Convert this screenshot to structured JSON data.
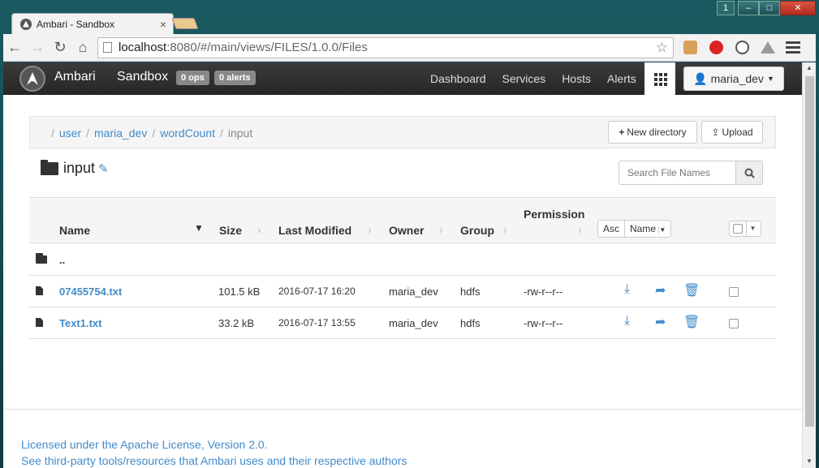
{
  "browser": {
    "tab_title": "Ambari - Sandbox",
    "tab_close": "×",
    "user_badge": "1",
    "url_host": "localhost",
    "url_rest": ":8080/#/main/views/FILES/1.0.0/Files",
    "star": "☆"
  },
  "navbar": {
    "brand": "Ambari",
    "cluster": "Sandbox",
    "ops_badge": "0 ops",
    "alerts_badge": "0 alerts",
    "links": [
      "Dashboard",
      "Services",
      "Hosts",
      "Alerts"
    ],
    "user": "maria_dev"
  },
  "breadcrumb": {
    "items": [
      "user",
      "maria_dev",
      "wordCount"
    ],
    "current": "input",
    "sep": "/"
  },
  "toolbar": {
    "new_directory": "New directory",
    "upload": "Upload"
  },
  "folder": {
    "name": "input"
  },
  "search": {
    "placeholder": "Search File Names"
  },
  "table": {
    "headers": {
      "name": "Name",
      "size": "Size",
      "modified": "Last Modified",
      "owner": "Owner",
      "group": "Group",
      "permission": "Permission"
    },
    "sort": {
      "order": "Asc",
      "field": "Name"
    },
    "parent": "..",
    "rows": [
      {
        "name": "07455754.txt",
        "size": "101.5 kB",
        "modified": "2016-07-17 16:20",
        "owner": "maria_dev",
        "group": "hdfs",
        "permission": "-rw-r--r--"
      },
      {
        "name": "Text1.txt",
        "size": "33.2 kB",
        "modified": "2016-07-17 13:55",
        "owner": "maria_dev",
        "group": "hdfs",
        "permission": "-rw-r--r--"
      }
    ]
  },
  "footer": {
    "license": "Licensed under the Apache License, Version 2.0.",
    "third_party": "See third-party tools/resources that Ambari uses and their respective authors"
  },
  "colors": {
    "link": "#428bca",
    "navbar": "#2f2f2f"
  }
}
